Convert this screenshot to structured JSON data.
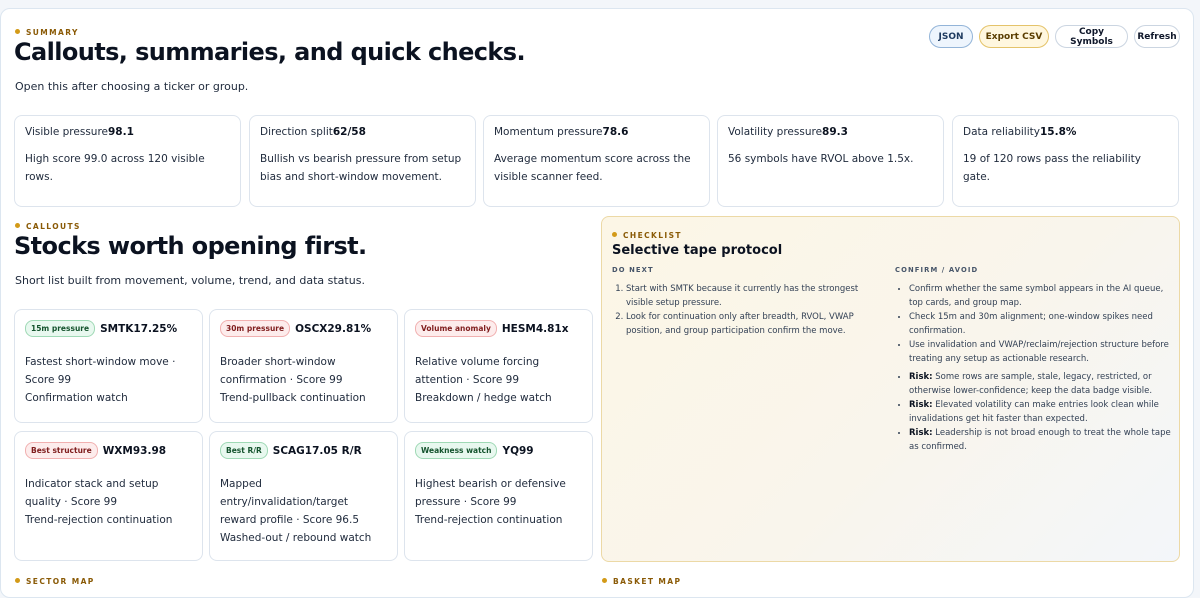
{
  "summary": {
    "eyebrow": "SUMMARY",
    "title": "Callouts, summaries, and quick checks.",
    "lede": "Open this after choosing a ticker or group."
  },
  "toolbar": {
    "json_label": "JSON",
    "export_csv_label": "Export CSV",
    "copy_symbols_label": "Copy Symbols",
    "refresh_label": "Refresh"
  },
  "metrics": [
    {
      "label": "Visible pressure",
      "value": "98.1",
      "desc": "High score 99.0 across 120 visible rows."
    },
    {
      "label": "Direction split",
      "value": "62/58",
      "desc": "Bullish vs bearish pressure from setup bias and short-window movement."
    },
    {
      "label": "Momentum pressure",
      "value": "78.6",
      "desc": "Average momentum score across the visible scanner feed."
    },
    {
      "label": "Volatility pressure",
      "value": "89.3",
      "desc": "56 symbols have RVOL above 1.5x."
    },
    {
      "label": "Data reliability",
      "value": "15.8%",
      "desc": "19 of 120 rows pass the reliability gate."
    }
  ],
  "callouts": {
    "eyebrow": "CALLOUTS",
    "title": "Stocks worth opening first.",
    "lede": "Short list built from movement, volume, trend, and data status.",
    "cards": [
      {
        "tag": "15m pressure",
        "tag_color": "green",
        "headline": "SMTK17.25%",
        "lines": [
          "Fastest short-window move · Score 99",
          "Confirmation watch"
        ]
      },
      {
        "tag": "30m pressure",
        "tag_color": "red",
        "headline": "OSCX29.81%",
        "lines": [
          "Broader short-window confirmation · Score 99",
          "Trend-pullback continuation"
        ]
      },
      {
        "tag": "Volume anomaly",
        "tag_color": "red",
        "headline": "HESM4.81x",
        "lines": [
          "Relative volume forcing attention · Score 99",
          "Breakdown / hedge watch"
        ]
      },
      {
        "tag": "Best structure",
        "tag_color": "red",
        "headline": "WXM93.98",
        "lines": [
          "Indicator stack and setup quality · Score 99",
          "Trend-rejection continuation"
        ]
      },
      {
        "tag": "Best R/R",
        "tag_color": "green",
        "headline": "SCAG17.05 R/R",
        "lines": [
          "Mapped entry/invalidation/target reward profile · Score 96.5",
          "Washed-out / rebound watch"
        ]
      },
      {
        "tag": "Weakness watch",
        "tag_color": "green",
        "headline": "YQ99",
        "lines": [
          "Highest bearish or defensive pressure · Score 99",
          "Trend-rejection continuation"
        ]
      }
    ]
  },
  "checklist": {
    "eyebrow": "CHECKLIST",
    "title": "Selective tape protocol",
    "do_next_heading": "DO NEXT",
    "do_next": [
      "Start with SMTK because it currently has the strongest visible setup pressure.",
      "Look for continuation only after breadth, RVOL, VWAP position, and group participation confirm the move."
    ],
    "confirm_heading": "CONFIRM / AVOID",
    "confirm": [
      "Confirm whether the same symbol appears in the AI queue, top cards, and group map.",
      "Check 15m and 30m alignment; one-window spikes need confirmation.",
      "Use invalidation and VWAP/reclaim/rejection structure before treating any setup as actionable research."
    ],
    "risks": [
      {
        "label": "Risk:",
        "text": "Some rows are sample, stale, legacy, restricted, or otherwise lower-confidence; keep the data badge visible."
      },
      {
        "label": "Risk:",
        "text": "Elevated volatility can make entries look clean while invalidations get hit faster than expected."
      },
      {
        "label": "Risk:",
        "text": "Leadership is not broad enough to treat the whole tape as confirmed."
      }
    ]
  },
  "footer": {
    "sector_map": "SECTOR MAP",
    "basket_map": "BASKET MAP"
  },
  "colors": {
    "accent_gold": "#d39a18",
    "pill_green": "#e8f8ef",
    "pill_red": "#fdecec"
  }
}
